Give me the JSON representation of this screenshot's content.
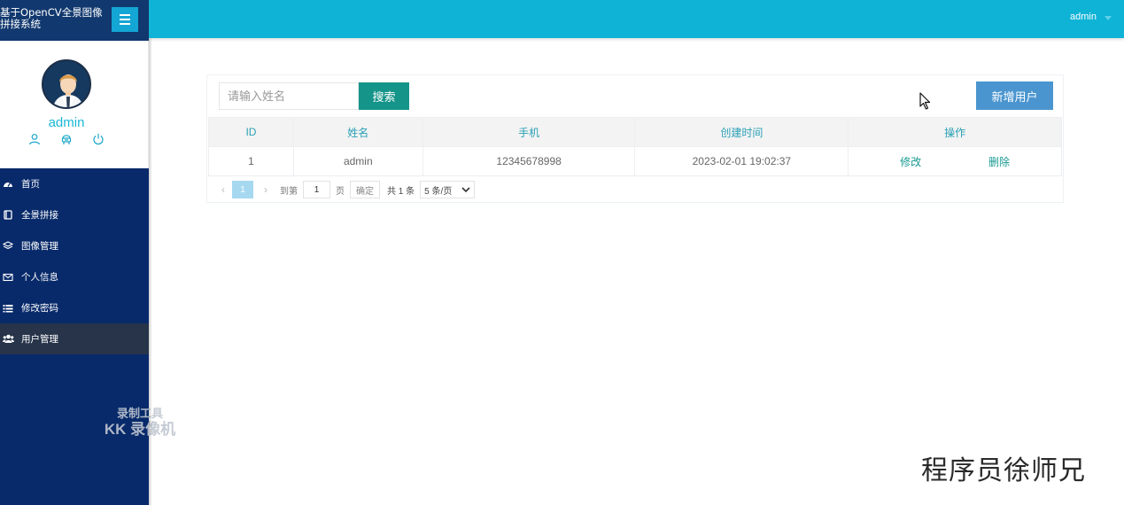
{
  "app": {
    "title": "基于OpenCV全景图像拼接系统"
  },
  "topbar": {
    "username": "admin"
  },
  "user_panel": {
    "name": "admin",
    "icons": [
      "user-icon",
      "settings-icon",
      "power-icon"
    ]
  },
  "nav": {
    "items": [
      {
        "label": "首页",
        "icon": "dashboard-icon",
        "active": false
      },
      {
        "label": "全景拼接",
        "icon": "book-icon",
        "active": false
      },
      {
        "label": "图像管理",
        "icon": "layers-icon",
        "active": false
      },
      {
        "label": "个人信息",
        "icon": "envelope-icon",
        "active": false
      },
      {
        "label": "修改密码",
        "icon": "list-icon",
        "active": false
      },
      {
        "label": "用户管理",
        "icon": "users-icon",
        "active": true
      }
    ]
  },
  "search": {
    "placeholder": "请输入姓名",
    "button_label": "搜索"
  },
  "toolbar": {
    "add_label": "新增用户"
  },
  "table": {
    "columns": [
      "ID",
      "姓名",
      "手机",
      "创建时间",
      "操作"
    ],
    "rows": [
      {
        "id": "1",
        "name": "admin",
        "phone": "12345678998",
        "created": "2023-02-01 19:02:37",
        "edit": "修改",
        "delete": "删除"
      }
    ]
  },
  "pagination": {
    "current_page": "1",
    "goto_label": "到第",
    "goto_value": "1",
    "page_suffix": "页",
    "confirm_label": "确定",
    "total_label": "共 1 条",
    "page_size_label": "5 条/页"
  },
  "watermark": {
    "line1": "录制工具",
    "line2": "KK 录像机"
  },
  "signature": "程序员徐师兄",
  "colors": {
    "topbar": "#0fb3d6",
    "sidebar": "#082a6a",
    "search_button": "#159489",
    "add_button": "#4a95cf",
    "active_nav": "#27344a"
  }
}
